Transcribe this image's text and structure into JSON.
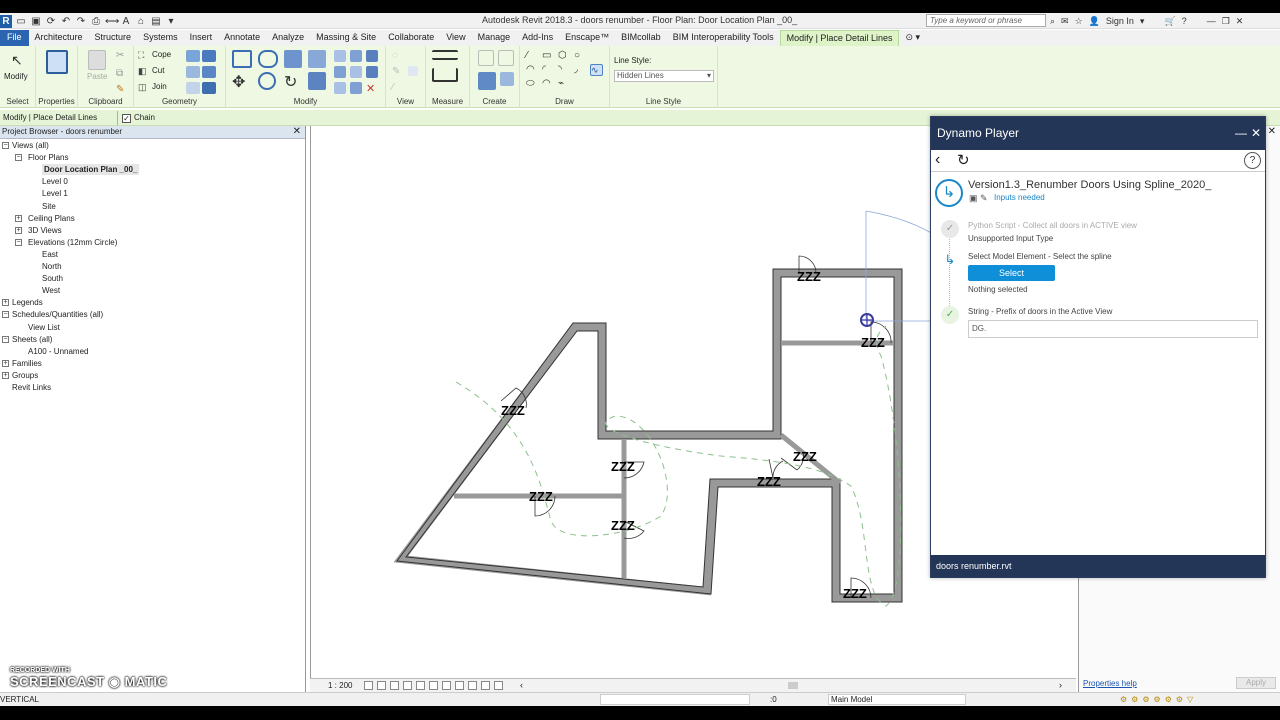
{
  "app": {
    "title": "Autodesk Revit 2018.3 -    doors renumber - Floor Plan: Door Location Plan _00_",
    "search_placeholder": "Type a keyword or phrase",
    "sign_in": "Sign In"
  },
  "ribbon_tabs": [
    "File",
    "Architecture",
    "Structure",
    "Systems",
    "Insert",
    "Annotate",
    "Analyze",
    "Massing & Site",
    "Collaborate",
    "View",
    "Manage",
    "Add-Ins",
    "Enscape™",
    "BIMcollab",
    "BIM Interoperability Tools",
    "Modify | Place Detail Lines"
  ],
  "ribbon": {
    "modify_label": "Modify",
    "paste_label": "Paste",
    "cope_label": "Cope",
    "cut_label": "Cut",
    "join_label": "Join",
    "line_style_label": "Line Style:",
    "line_style_value": "Hidden Lines",
    "panels": [
      "Select",
      "Properties",
      "Clipboard",
      "Geometry",
      "Modify",
      "View",
      "Measure",
      "Create",
      "Draw",
      "Line Style"
    ]
  },
  "options_bar": {
    "context": "Modify | Place Detail Lines",
    "chain_label": "Chain",
    "chain_checked": true
  },
  "project_browser": {
    "title": "Project Browser - doors renumber",
    "items": [
      {
        "label": "Views (all)",
        "level": 0
      },
      {
        "label": "Floor Plans",
        "level": 1
      },
      {
        "label": "Door Location Plan _00_",
        "level": 2,
        "selected": true
      },
      {
        "label": "Level 0",
        "level": 2
      },
      {
        "label": "Level 1",
        "level": 2
      },
      {
        "label": "Site",
        "level": 2
      },
      {
        "label": "Ceiling Plans",
        "level": 1
      },
      {
        "label": "3D Views",
        "level": 1
      },
      {
        "label": "Elevations (12mm Circle)",
        "level": 1
      },
      {
        "label": "East",
        "level": 2
      },
      {
        "label": "North",
        "level": 2
      },
      {
        "label": "South",
        "level": 2
      },
      {
        "label": "West",
        "level": 2
      },
      {
        "label": "Legends",
        "level": 0
      },
      {
        "label": "Schedules/Quantities (all)",
        "level": 0
      },
      {
        "label": "View List",
        "level": 1
      },
      {
        "label": "Sheets (all)",
        "level": 0
      },
      {
        "label": "A100 - Unnamed",
        "level": 1
      },
      {
        "label": "Families",
        "level": 0
      },
      {
        "label": "Groups",
        "level": 0
      },
      {
        "label": "Revit Links",
        "level": 0
      }
    ]
  },
  "canvas": {
    "door_tags": [
      "ZZZ",
      "ZZZ",
      "ZZZ",
      "ZZZ",
      "ZZZ",
      "ZZZ",
      "ZZZ",
      "ZZZ",
      "ZZZ"
    ],
    "scale": "1 : 200"
  },
  "properties": {
    "help_link": "Properties help",
    "apply": "Apply"
  },
  "dynamo": {
    "title": "Dynamo Player",
    "script_name": "Version1.3_Renumber Doors Using Spline_2020_",
    "inputs_needed": "Inputs needed",
    "steps": [
      {
        "title": "Python Script - Collect all doors in ACTIVE view",
        "sub": "Unsupported Input Type",
        "status": "done-muted"
      },
      {
        "title": "Select Model Element - Select the spline",
        "sub": "Nothing selected",
        "status": "pending"
      },
      {
        "title": "String - Prefix of doors in the Active View",
        "value": "DG.",
        "status": "done"
      }
    ],
    "select_button": "Select",
    "footer_file": "doors renumber.rvt"
  },
  "status_bar": {
    "text": "VERTICAL",
    "zero": ":0",
    "model": "Main Model"
  },
  "watermark": {
    "recorded_with": "RECORDED WITH",
    "brand": "SCREENCAST ◉ MATIC"
  },
  "colors": {
    "ribbon_bg": "#eef8e2",
    "dynamo_header": "#243657",
    "accent_blue": "#0f8fd8",
    "file_tab": "#2b65b1"
  }
}
